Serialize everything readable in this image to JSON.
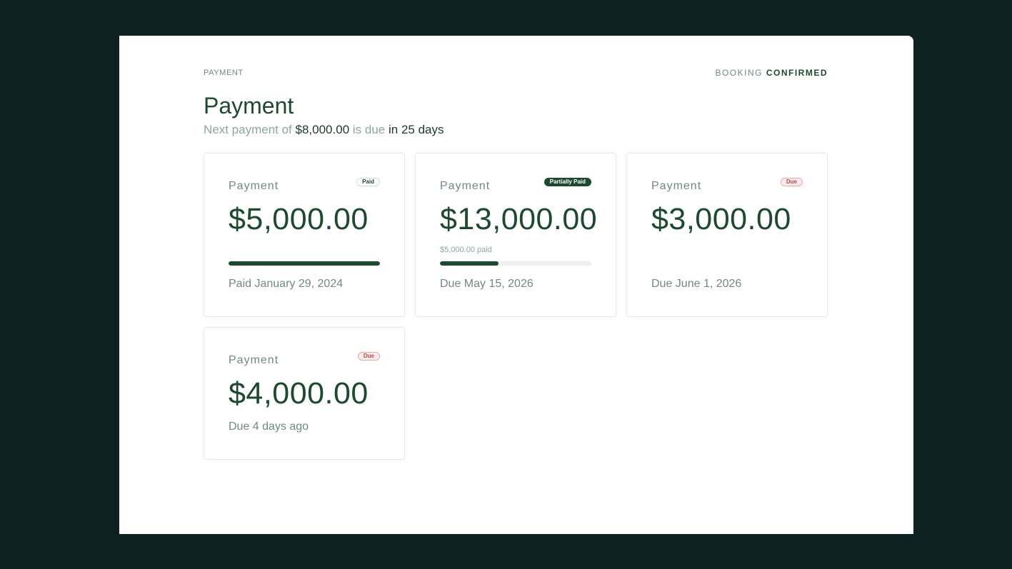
{
  "breadcrumb": "PAYMENT",
  "booking_status": {
    "prefix": "BOOKING",
    "value": "CONFIRMED"
  },
  "page": {
    "title": "Payment",
    "subtitle": {
      "prefix": "Next payment of",
      "amount": "$8,000.00",
      "middle": "is due",
      "when": "in 25 days"
    }
  },
  "colors": {
    "brand": "#1c4a2e",
    "muted": "#6f8a7f",
    "due": "#c0463f",
    "background": "#0f2020"
  },
  "cards": [
    {
      "label": "Payment",
      "badge": "Paid",
      "amount": "$5,000.00",
      "progress": 1.0,
      "paid_note": "",
      "date": "Paid January 29, 2024"
    },
    {
      "label": "Payment",
      "badge": "Partially Paid",
      "amount": "$13,000.00",
      "progress": 0.385,
      "paid_note": "$5,000.00 paid",
      "date": "Due May 15, 2026"
    },
    {
      "label": "Payment",
      "badge": "Due",
      "amount": "$3,000.00",
      "progress": null,
      "paid_note": "",
      "date": "Due June 1, 2026"
    },
    {
      "label": "Payment",
      "badge": "Due",
      "amount": "$4,000.00",
      "progress": null,
      "paid_note": "",
      "date": "Due 4 days ago"
    }
  ]
}
